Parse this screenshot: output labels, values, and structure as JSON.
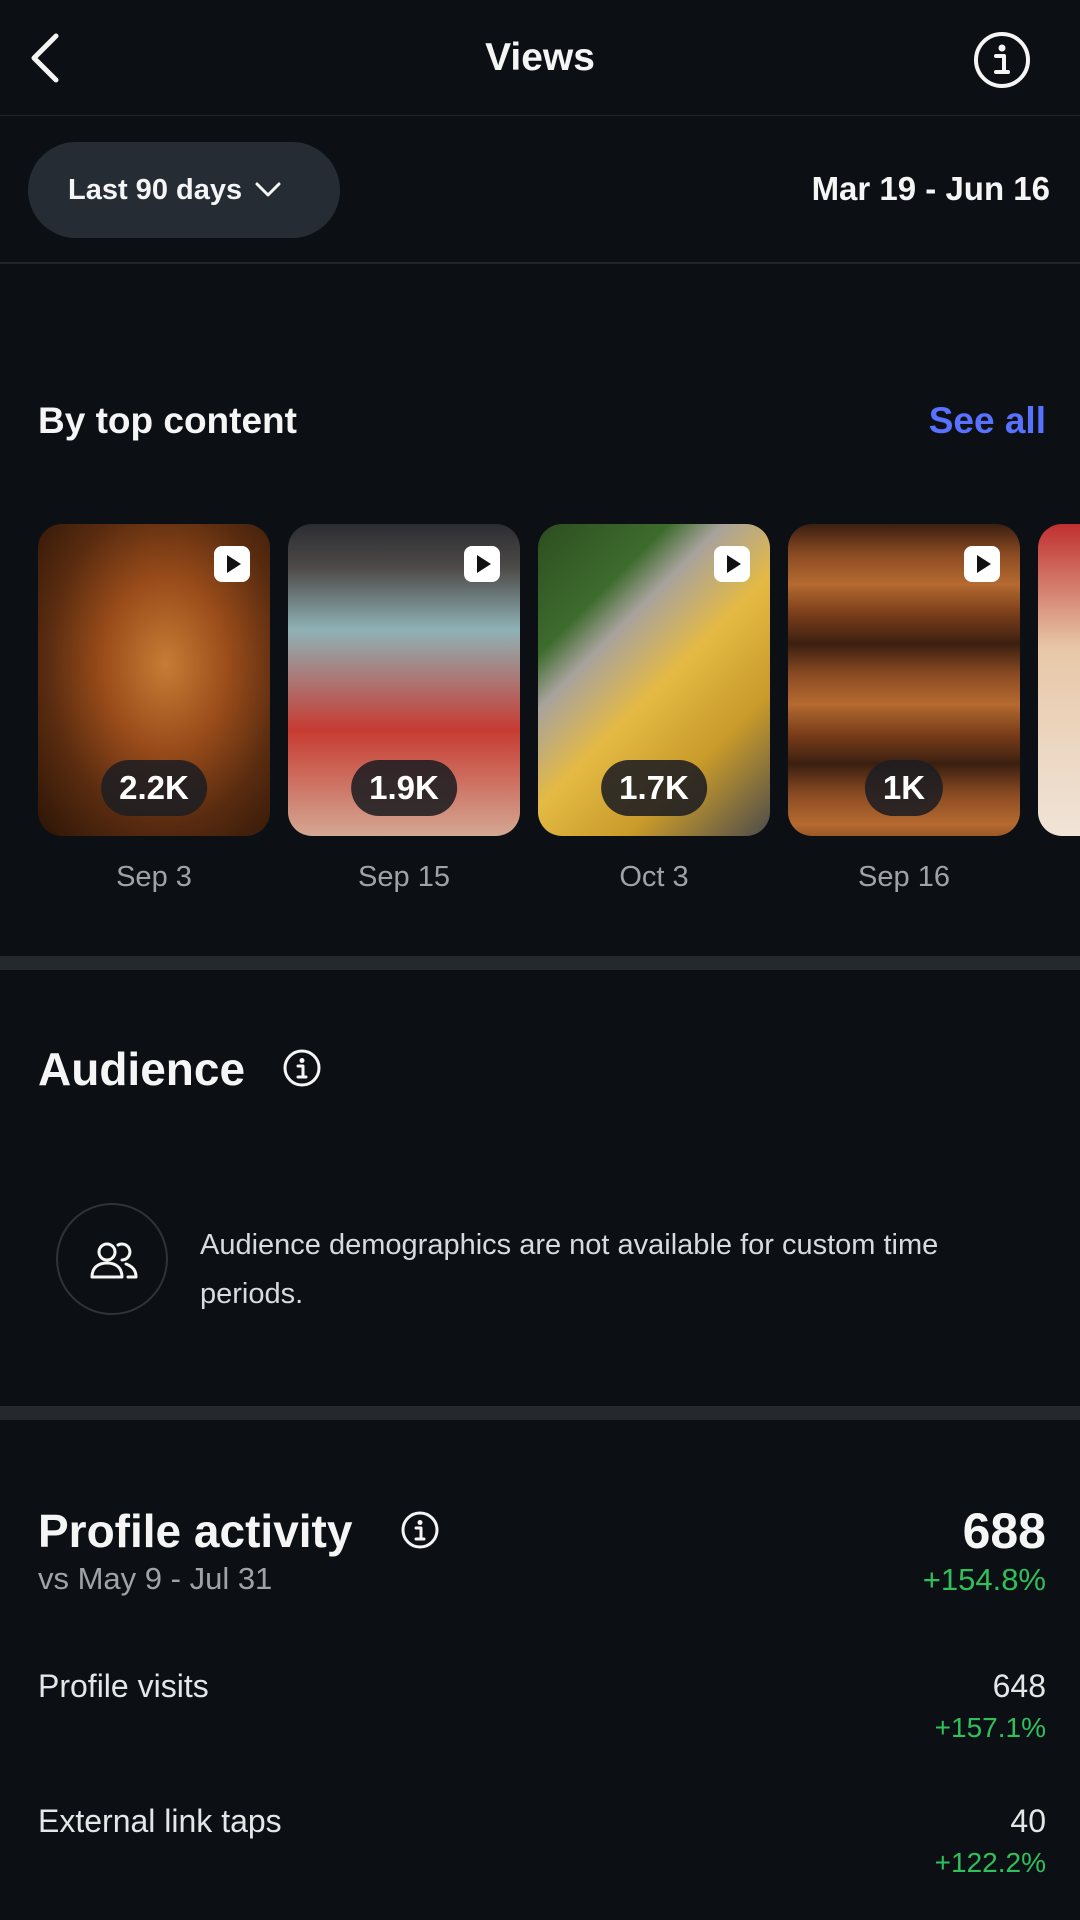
{
  "header": {
    "title": "Views"
  },
  "filter": {
    "period_label": "Last 90 days",
    "date_range": "Mar 19 - Jun 16"
  },
  "top_content": {
    "heading": "By top content",
    "see_all_label": "See all",
    "items": [
      {
        "views": "2.2K",
        "date": "Sep 3"
      },
      {
        "views": "1.9K",
        "date": "Sep 15"
      },
      {
        "views": "1.7K",
        "date": "Oct 3"
      },
      {
        "views": "1K",
        "date": "Sep 16"
      }
    ]
  },
  "audience": {
    "heading": "Audience",
    "message": "Audience demographics are not available for custom time periods."
  },
  "profile_activity": {
    "heading": "Profile activity",
    "comparison": "vs May 9 - Jul 31",
    "total": "688",
    "total_delta": "+154.8%",
    "rows": [
      {
        "label": "Profile visits",
        "value": "648",
        "delta": "+157.1%"
      },
      {
        "label": "External link taps",
        "value": "40",
        "delta": "+122.2%"
      }
    ]
  },
  "colors": {
    "background": "#0c1014",
    "accent_link": "#5872ff",
    "positive_delta": "#2fbf5b",
    "pill_background": "#262c33"
  },
  "icons": [
    "back-arrow-icon",
    "info-icon",
    "chevron-down-icon",
    "reel-play-icon",
    "people-icon"
  ]
}
